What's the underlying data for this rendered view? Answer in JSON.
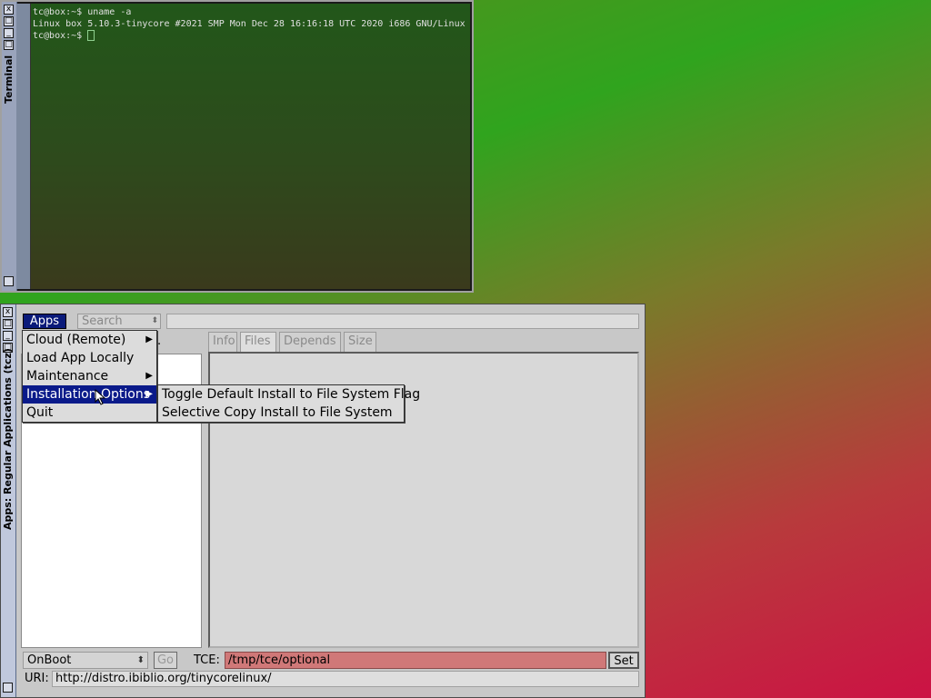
{
  "terminal": {
    "title": "Terminal",
    "lines": [
      "tc@box:~$ uname -a",
      "Linux box 5.10.3-tinycore #2021 SMP Mon Dec 28 16:16:18 UTC 2020 i686 GNU/Linux",
      "tc@box:~$ "
    ]
  },
  "apps_window": {
    "title": "Apps: Regular Applications (tcz)",
    "menu_button": "Apps",
    "search_combo": "Search",
    "tabs": [
      {
        "label": "Info"
      },
      {
        "label": "Files"
      },
      {
        "label": "Depends"
      },
      {
        "label": "Size"
      }
    ],
    "partial_label": ".",
    "onboot_combo": "OnBoot",
    "go_button": "Go",
    "tce_label": "TCE:",
    "tce_value": "/tmp/tce/optional",
    "set_button": "Set",
    "uri_label": "URI:",
    "uri_value": "http://distro.ibiblio.org/tinycorelinux/"
  },
  "apps_menu": {
    "items": [
      {
        "label": "Cloud (Remote)",
        "submenu": true
      },
      {
        "label": "Load App Locally",
        "submenu": false
      },
      {
        "label": "Maintenance",
        "submenu": true
      },
      {
        "label": "Installation Options",
        "submenu": true,
        "selected": true
      },
      {
        "label": "Quit",
        "submenu": false
      }
    ]
  },
  "install_submenu": {
    "items": [
      {
        "label": "Toggle Default Install to File System Flag"
      },
      {
        "label": "Selective Copy Install to File System"
      }
    ]
  },
  "colors": {
    "menu_highlight": "#0a1a8a",
    "tce_field": "#d07878"
  }
}
